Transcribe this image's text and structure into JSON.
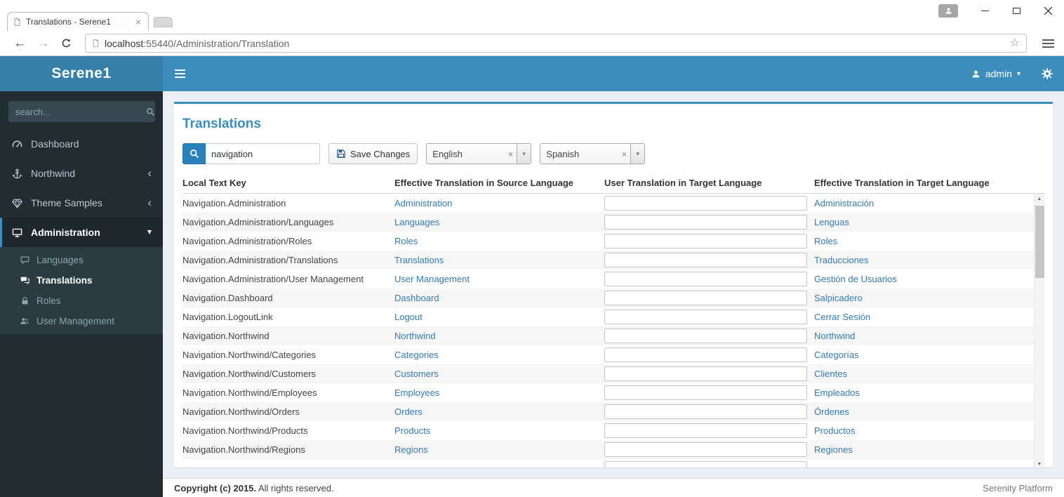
{
  "browser": {
    "tab_title": "Translations - Serene1",
    "url_host": "localhost",
    "url_path": ":55440/Administration/Translation"
  },
  "navbar": {
    "user": "admin"
  },
  "sidebar": {
    "brand": "Serene1",
    "search_placeholder": "search...",
    "items": [
      {
        "label": "Dashboard"
      },
      {
        "label": "Northwind"
      },
      {
        "label": "Theme Samples"
      },
      {
        "label": "Administration"
      }
    ],
    "submenu": [
      {
        "label": "Languages"
      },
      {
        "label": "Translations"
      },
      {
        "label": "Roles"
      },
      {
        "label": "User Management"
      }
    ]
  },
  "page": {
    "title": "Translations",
    "search_value": "navigation",
    "save_label": "Save Changes",
    "source_language": "English",
    "target_language": "Spanish"
  },
  "grid": {
    "headers": [
      "Local Text Key",
      "Effective Translation in Source Language",
      "User Translation in Target Language",
      "Effective Translation in Target Language"
    ],
    "rows": [
      {
        "key": "Navigation.Administration",
        "source": "Administration",
        "user": "",
        "target": "Administración"
      },
      {
        "key": "Navigation.Administration/Languages",
        "source": "Languages",
        "user": "",
        "target": "Lenguas"
      },
      {
        "key": "Navigation.Administration/Roles",
        "source": "Roles",
        "user": "",
        "target": "Roles"
      },
      {
        "key": "Navigation.Administration/Translations",
        "source": "Translations",
        "user": "",
        "target": "Traducciones"
      },
      {
        "key": "Navigation.Administration/User Management",
        "source": "User Management",
        "user": "",
        "target": "Gestión de Usuarios"
      },
      {
        "key": "Navigation.Dashboard",
        "source": "Dashboard",
        "user": "",
        "target": "Salpicadero"
      },
      {
        "key": "Navigation.LogoutLink",
        "source": "Logout",
        "user": "",
        "target": "Cerrar Sesión"
      },
      {
        "key": "Navigation.Northwind",
        "source": "Northwind",
        "user": "",
        "target": "Northwind"
      },
      {
        "key": "Navigation.Northwind/Categories",
        "source": "Categories",
        "user": "",
        "target": "Categorías"
      },
      {
        "key": "Navigation.Northwind/Customers",
        "source": "Customers",
        "user": "",
        "target": "Clientes"
      },
      {
        "key": "Navigation.Northwind/Employees",
        "source": "Employees",
        "user": "",
        "target": "Empleados"
      },
      {
        "key": "Navigation.Northwind/Orders",
        "source": "Orders",
        "user": "",
        "target": "Órdenes"
      },
      {
        "key": "Navigation.Northwind/Products",
        "source": "Products",
        "user": "",
        "target": "Productos"
      },
      {
        "key": "Navigation.Northwind/Regions",
        "source": "Regions",
        "user": "",
        "target": "Regiones"
      },
      {
        "key": "",
        "source": "",
        "user": "",
        "target": ""
      }
    ]
  },
  "footer": {
    "bold": "Copyright (c) 2015.",
    "rest": "All rights reserved.",
    "right": "Serenity Platform"
  },
  "icons": {
    "chevron_left": "‹",
    "caret_down": "▾",
    "star": "☆",
    "close": "×",
    "scroll_up": "▲",
    "scroll_down": "▼"
  },
  "theme": {
    "navbar": "#3c8dbc",
    "sidebar": "#222d32",
    "accent": "#3c8dbc",
    "link": "#337ab7"
  }
}
